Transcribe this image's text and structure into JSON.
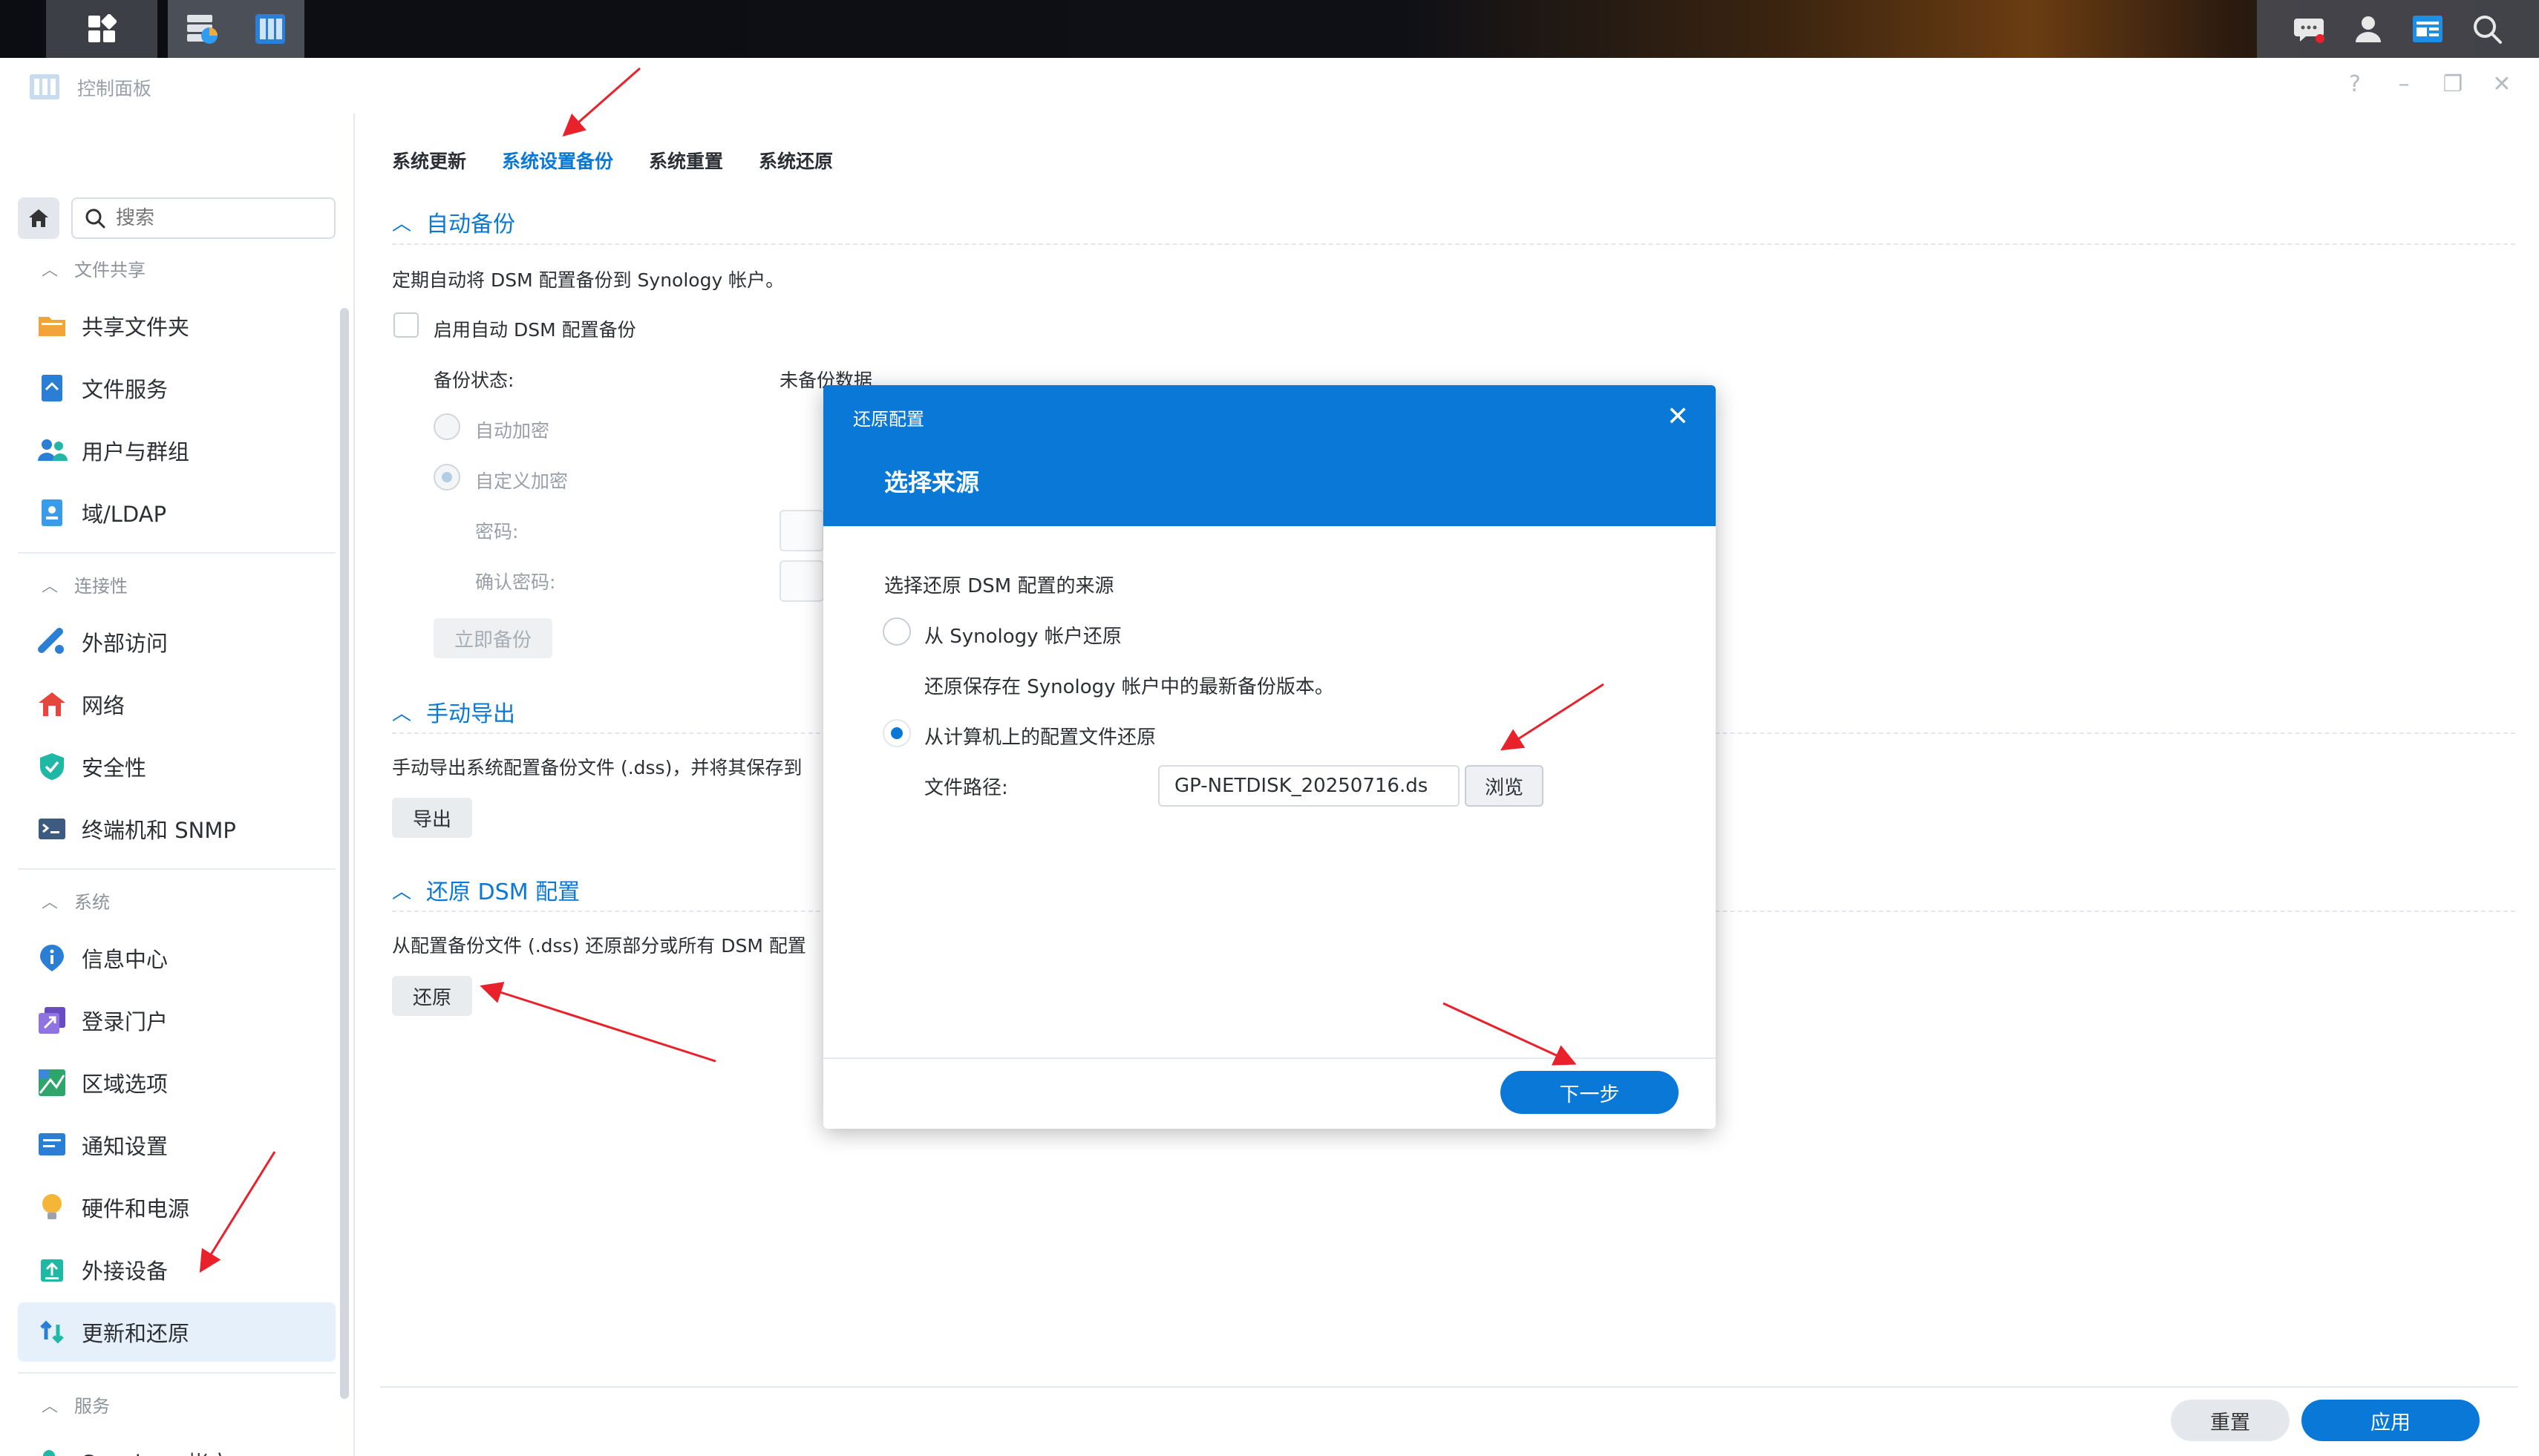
{
  "window": {
    "title": "控制面板"
  },
  "search": {
    "placeholder": "搜索"
  },
  "sidebar": {
    "sections": [
      {
        "label": "文件共享",
        "items": [
          "共享文件夹",
          "文件服务",
          "用户与群组",
          "域/LDAP"
        ]
      },
      {
        "label": "连接性",
        "items": [
          "外部访问",
          "网络",
          "安全性",
          "终端机和 SNMP"
        ]
      },
      {
        "label": "系统",
        "items": [
          "信息中心",
          "登录门户",
          "区域选项",
          "通知设置",
          "硬件和电源",
          "外接设备",
          "更新和还原"
        ]
      },
      {
        "label": "服务",
        "items": [
          "Synology 帐户"
        ]
      }
    ],
    "active_item": "更新和还原"
  },
  "tabs": [
    "系统更新",
    "系统设置备份",
    "系统重置",
    "系统还原"
  ],
  "active_tab": "系统设置备份",
  "auto_backup": {
    "title": "自动备份",
    "desc": "定期自动将 DSM 配置备份到 Synology 帐户。",
    "enable_label": "启用自动 DSM 配置备份",
    "status_label": "备份状态:",
    "status_value": "未备份数据",
    "auto_encrypt": "自动加密",
    "custom_encrypt": "自定义加密",
    "password_label": "密码:",
    "confirm_label": "确认密码:",
    "backup_now": "立即备份"
  },
  "manual_export": {
    "title": "手动导出",
    "desc": "手动导出系统配置备份文件 (.dss)，并将其保存到",
    "export_btn": "导出"
  },
  "restore": {
    "title": "还原 DSM 配置",
    "desc": "从配置备份文件 (.dss) 还原部分或所有 DSM 配置",
    "restore_btn": "还原"
  },
  "footer": {
    "reset": "重置",
    "apply": "应用"
  },
  "modal": {
    "small_title": "还原配置",
    "big_title": "选择来源",
    "question": "选择还原 DSM 配置的来源",
    "option1": "从 Synology 帐户还原",
    "option1_desc": "还原保存在 Synology 帐户中的最新备份版本。",
    "option2": "从计算机上的配置文件还原",
    "file_path_label": "文件路径:",
    "file_path_value": "GP-NETDISK_20250716.ds",
    "browse": "浏览",
    "next": "下一步",
    "selected_option": 2
  },
  "colors": {
    "accent": "#0a78d6",
    "annotation": "#e8212b"
  }
}
